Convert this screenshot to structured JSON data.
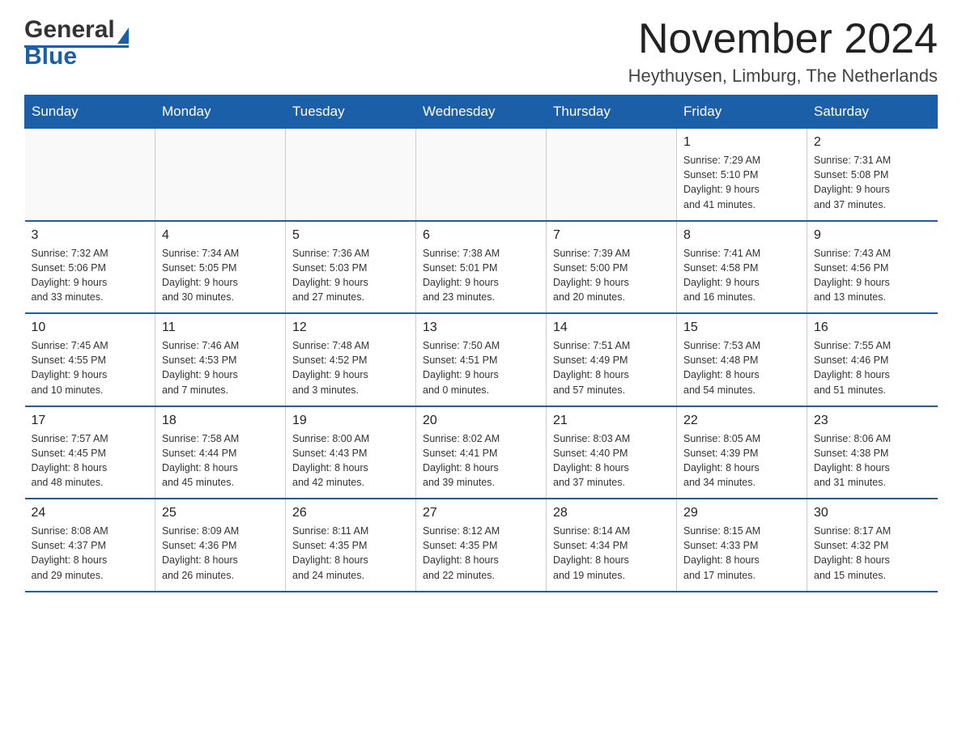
{
  "header": {
    "title": "November 2024",
    "subtitle": "Heythuysen, Limburg, The Netherlands",
    "logo_general": "General",
    "logo_blue": "Blue"
  },
  "days_of_week": [
    "Sunday",
    "Monday",
    "Tuesday",
    "Wednesday",
    "Thursday",
    "Friday",
    "Saturday"
  ],
  "weeks": [
    [
      {
        "day": "",
        "info": ""
      },
      {
        "day": "",
        "info": ""
      },
      {
        "day": "",
        "info": ""
      },
      {
        "day": "",
        "info": ""
      },
      {
        "day": "",
        "info": ""
      },
      {
        "day": "1",
        "info": "Sunrise: 7:29 AM\nSunset: 5:10 PM\nDaylight: 9 hours\nand 41 minutes."
      },
      {
        "day": "2",
        "info": "Sunrise: 7:31 AM\nSunset: 5:08 PM\nDaylight: 9 hours\nand 37 minutes."
      }
    ],
    [
      {
        "day": "3",
        "info": "Sunrise: 7:32 AM\nSunset: 5:06 PM\nDaylight: 9 hours\nand 33 minutes."
      },
      {
        "day": "4",
        "info": "Sunrise: 7:34 AM\nSunset: 5:05 PM\nDaylight: 9 hours\nand 30 minutes."
      },
      {
        "day": "5",
        "info": "Sunrise: 7:36 AM\nSunset: 5:03 PM\nDaylight: 9 hours\nand 27 minutes."
      },
      {
        "day": "6",
        "info": "Sunrise: 7:38 AM\nSunset: 5:01 PM\nDaylight: 9 hours\nand 23 minutes."
      },
      {
        "day": "7",
        "info": "Sunrise: 7:39 AM\nSunset: 5:00 PM\nDaylight: 9 hours\nand 20 minutes."
      },
      {
        "day": "8",
        "info": "Sunrise: 7:41 AM\nSunset: 4:58 PM\nDaylight: 9 hours\nand 16 minutes."
      },
      {
        "day": "9",
        "info": "Sunrise: 7:43 AM\nSunset: 4:56 PM\nDaylight: 9 hours\nand 13 minutes."
      }
    ],
    [
      {
        "day": "10",
        "info": "Sunrise: 7:45 AM\nSunset: 4:55 PM\nDaylight: 9 hours\nand 10 minutes."
      },
      {
        "day": "11",
        "info": "Sunrise: 7:46 AM\nSunset: 4:53 PM\nDaylight: 9 hours\nand 7 minutes."
      },
      {
        "day": "12",
        "info": "Sunrise: 7:48 AM\nSunset: 4:52 PM\nDaylight: 9 hours\nand 3 minutes."
      },
      {
        "day": "13",
        "info": "Sunrise: 7:50 AM\nSunset: 4:51 PM\nDaylight: 9 hours\nand 0 minutes."
      },
      {
        "day": "14",
        "info": "Sunrise: 7:51 AM\nSunset: 4:49 PM\nDaylight: 8 hours\nand 57 minutes."
      },
      {
        "day": "15",
        "info": "Sunrise: 7:53 AM\nSunset: 4:48 PM\nDaylight: 8 hours\nand 54 minutes."
      },
      {
        "day": "16",
        "info": "Sunrise: 7:55 AM\nSunset: 4:46 PM\nDaylight: 8 hours\nand 51 minutes."
      }
    ],
    [
      {
        "day": "17",
        "info": "Sunrise: 7:57 AM\nSunset: 4:45 PM\nDaylight: 8 hours\nand 48 minutes."
      },
      {
        "day": "18",
        "info": "Sunrise: 7:58 AM\nSunset: 4:44 PM\nDaylight: 8 hours\nand 45 minutes."
      },
      {
        "day": "19",
        "info": "Sunrise: 8:00 AM\nSunset: 4:43 PM\nDaylight: 8 hours\nand 42 minutes."
      },
      {
        "day": "20",
        "info": "Sunrise: 8:02 AM\nSunset: 4:41 PM\nDaylight: 8 hours\nand 39 minutes."
      },
      {
        "day": "21",
        "info": "Sunrise: 8:03 AM\nSunset: 4:40 PM\nDaylight: 8 hours\nand 37 minutes."
      },
      {
        "day": "22",
        "info": "Sunrise: 8:05 AM\nSunset: 4:39 PM\nDaylight: 8 hours\nand 34 minutes."
      },
      {
        "day": "23",
        "info": "Sunrise: 8:06 AM\nSunset: 4:38 PM\nDaylight: 8 hours\nand 31 minutes."
      }
    ],
    [
      {
        "day": "24",
        "info": "Sunrise: 8:08 AM\nSunset: 4:37 PM\nDaylight: 8 hours\nand 29 minutes."
      },
      {
        "day": "25",
        "info": "Sunrise: 8:09 AM\nSunset: 4:36 PM\nDaylight: 8 hours\nand 26 minutes."
      },
      {
        "day": "26",
        "info": "Sunrise: 8:11 AM\nSunset: 4:35 PM\nDaylight: 8 hours\nand 24 minutes."
      },
      {
        "day": "27",
        "info": "Sunrise: 8:12 AM\nSunset: 4:35 PM\nDaylight: 8 hours\nand 22 minutes."
      },
      {
        "day": "28",
        "info": "Sunrise: 8:14 AM\nSunset: 4:34 PM\nDaylight: 8 hours\nand 19 minutes."
      },
      {
        "day": "29",
        "info": "Sunrise: 8:15 AM\nSunset: 4:33 PM\nDaylight: 8 hours\nand 17 minutes."
      },
      {
        "day": "30",
        "info": "Sunrise: 8:17 AM\nSunset: 4:32 PM\nDaylight: 8 hours\nand 15 minutes."
      }
    ]
  ]
}
